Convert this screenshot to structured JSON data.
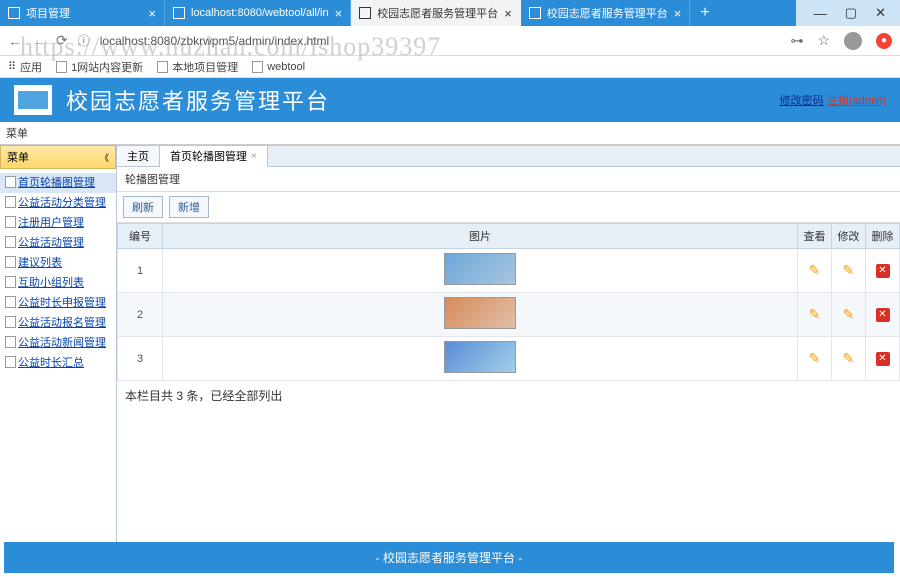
{
  "browser": {
    "tabs": [
      {
        "label": "项目管理"
      },
      {
        "label": "localhost:8080/webtool/all/in"
      },
      {
        "label": "校园志愿者服务管理平台"
      },
      {
        "label": "校园志愿者服务管理平台"
      }
    ],
    "url": "localhost:8080/zbkrwpm5/admin/index.html",
    "bookmarks": {
      "apps": "应用",
      "items": [
        "1网站内容更新",
        "本地项目管理",
        "webtool"
      ]
    }
  },
  "header": {
    "title": "校园志愿者服务管理平台",
    "link1": "修改密码",
    "link2": "注销(admin)"
  },
  "menu_label": "菜单",
  "sidebar": {
    "title": "菜单",
    "items": [
      "首页轮播图管理",
      "公益活动分类管理",
      "注册用户管理",
      "公益活动管理",
      "建议列表",
      "互助小组列表",
      "公益时长申报管理",
      "公益活动报名管理",
      "公益活动新闻管理",
      "公益时长汇总"
    ]
  },
  "pageTabs": {
    "home": "主页",
    "active": "首页轮播图管理"
  },
  "panel": {
    "title": "轮播图管理",
    "btn_refresh": "刷新",
    "btn_add": "新增"
  },
  "table": {
    "cols": {
      "id": "编号",
      "img": "图片",
      "view": "查看",
      "edit": "修改",
      "del": "删除"
    },
    "rows": [
      {
        "id": "1"
      },
      {
        "id": "2"
      },
      {
        "id": "3"
      }
    ],
    "summary": "本栏目共 3 条，已经全部列出"
  },
  "footer": "- 校园志愿者服务管理平台 -",
  "watermark": "https://www.huzhan.com/ishop39397"
}
